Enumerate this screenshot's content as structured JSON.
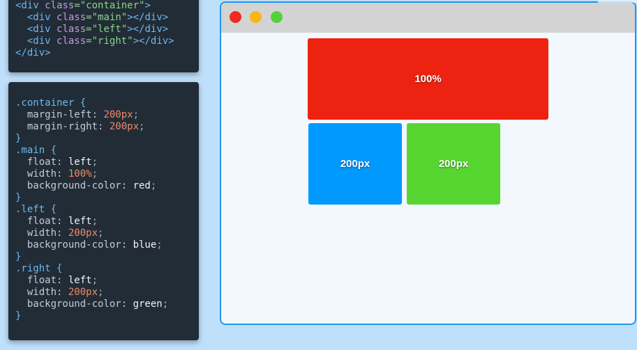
{
  "html_code": {
    "lines": [
      [
        {
          "t": "<div ",
          "c": "tag"
        },
        {
          "t": "class",
          "c": "attr"
        },
        {
          "t": "=\"container\"",
          "c": "str"
        },
        {
          "t": ">",
          "c": "tag"
        }
      ],
      [
        {
          "t": "  <div ",
          "c": "tag"
        },
        {
          "t": "class",
          "c": "attr"
        },
        {
          "t": "=\"main\"",
          "c": "str"
        },
        {
          "t": "></div>",
          "c": "tag"
        }
      ],
      [
        {
          "t": "  <div ",
          "c": "tag"
        },
        {
          "t": "class",
          "c": "attr"
        },
        {
          "t": "=\"left\"",
          "c": "str"
        },
        {
          "t": "></div>",
          "c": "tag"
        }
      ],
      [
        {
          "t": "  <div ",
          "c": "tag"
        },
        {
          "t": "class",
          "c": "attr"
        },
        {
          "t": "=\"right\"",
          "c": "str"
        },
        {
          "t": "></div>",
          "c": "tag"
        }
      ],
      [
        {
          "t": "</div>",
          "c": "tag"
        }
      ]
    ]
  },
  "css_code": {
    "lines": [
      [
        {
          "t": ".container {",
          "c": "sel"
        }
      ],
      [
        {
          "t": "  margin-left: ",
          "c": "prop"
        },
        {
          "t": "200px",
          "c": "num"
        },
        {
          "t": ";",
          "c": "punc"
        }
      ],
      [
        {
          "t": "  margin-right: ",
          "c": "prop"
        },
        {
          "t": "200px",
          "c": "num"
        },
        {
          "t": ";",
          "c": "punc"
        }
      ],
      [
        {
          "t": "}",
          "c": "sel"
        }
      ],
      [
        {
          "t": ".main {",
          "c": "sel"
        }
      ],
      [
        {
          "t": "  float: ",
          "c": "prop"
        },
        {
          "t": "left",
          "c": "kw"
        },
        {
          "t": ";",
          "c": "punc"
        }
      ],
      [
        {
          "t": "  width: ",
          "c": "prop"
        },
        {
          "t": "100%",
          "c": "num"
        },
        {
          "t": ";",
          "c": "punc"
        }
      ],
      [
        {
          "t": "  background-color: ",
          "c": "prop"
        },
        {
          "t": "red",
          "c": "kw"
        },
        {
          "t": ";",
          "c": "punc"
        }
      ],
      [
        {
          "t": "}",
          "c": "sel"
        }
      ],
      [
        {
          "t": ".left {",
          "c": "sel"
        }
      ],
      [
        {
          "t": "  float: ",
          "c": "prop"
        },
        {
          "t": "left",
          "c": "kw"
        },
        {
          "t": ";",
          "c": "punc"
        }
      ],
      [
        {
          "t": "  width: ",
          "c": "prop"
        },
        {
          "t": "200px",
          "c": "num"
        },
        {
          "t": ";",
          "c": "punc"
        }
      ],
      [
        {
          "t": "  background-color: ",
          "c": "prop"
        },
        {
          "t": "blue",
          "c": "kw"
        },
        {
          "t": ";",
          "c": "punc"
        }
      ],
      [
        {
          "t": "}",
          "c": "sel"
        }
      ],
      [
        {
          "t": ".right {",
          "c": "sel"
        }
      ],
      [
        {
          "t": "  float: ",
          "c": "prop"
        },
        {
          "t": "left",
          "c": "kw"
        },
        {
          "t": ";",
          "c": "punc"
        }
      ],
      [
        {
          "t": "  width: ",
          "c": "prop"
        },
        {
          "t": "200px",
          "c": "num"
        },
        {
          "t": ";",
          "c": "punc"
        }
      ],
      [
        {
          "t": "  background-color: ",
          "c": "prop"
        },
        {
          "t": "green",
          "c": "kw"
        },
        {
          "t": ";",
          "c": "punc"
        }
      ],
      [
        {
          "t": "}",
          "c": "sel"
        }
      ]
    ]
  },
  "browser": {
    "boxes": {
      "main": {
        "label": "100%",
        "color": "#ee2211"
      },
      "left": {
        "label": "200px",
        "color": "#0099fe"
      },
      "right": {
        "label": "200px",
        "color": "#57d632"
      }
    },
    "window_buttons": {
      "close": "#ee2b22",
      "minimize": "#f5b617",
      "maximize": "#52d139"
    }
  },
  "colors": {
    "background": "#bfe0fb",
    "code_bg": "#222c36",
    "window_border": "#1f95e8"
  }
}
